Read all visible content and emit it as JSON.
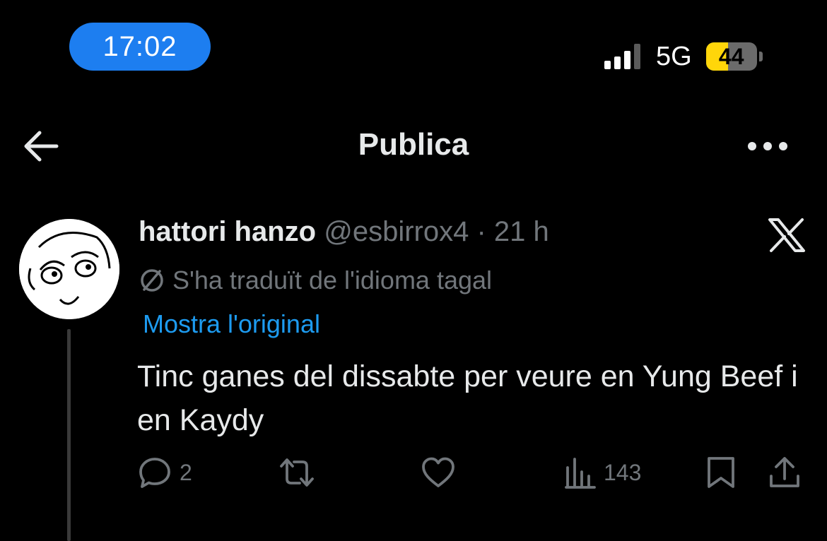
{
  "status_bar": {
    "time": "17:02",
    "network": "5G",
    "battery_level": "44",
    "battery_fraction": 0.44,
    "signal_bars_active": 3,
    "signal_bars_total": 4
  },
  "nav": {
    "title": "Publica",
    "back_icon": "arrow-left-icon",
    "more_icon": "more-horizontal-icon"
  },
  "tweet": {
    "author": {
      "display_name": "hattori hanzo",
      "handle": "@esbirrox4",
      "separator": "·",
      "age": "21 h",
      "avatar": "rage-face-avatar"
    },
    "platform_icon": "x-logo-icon",
    "translation_notice": "S'ha traduït de l'idioma tagal",
    "show_original_label": "Mostra l'original",
    "text": "Tinc ganes del dissabte per veure en Yung Beef i en Kaydy",
    "actions": {
      "reply_count": "2",
      "retweet_count": "",
      "like_count": "",
      "views_count": "143"
    }
  },
  "colors": {
    "background": "#000000",
    "text_primary": "#e7e9ea",
    "text_secondary": "#71767b",
    "link": "#1d9bf0",
    "time_pill": "#1d7ef0",
    "battery": "#ffd60a"
  }
}
